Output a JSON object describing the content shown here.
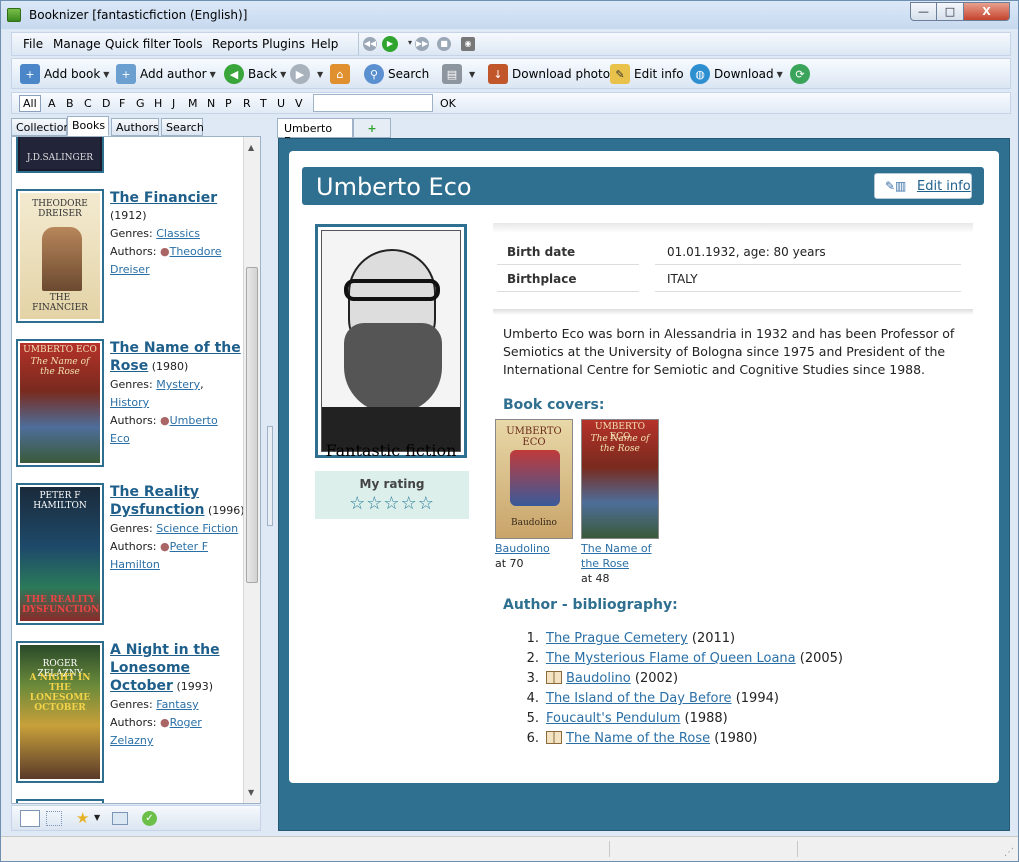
{
  "window": {
    "title": "Booknizer [fantasticfiction (English)]",
    "min_glyph": "—",
    "max_glyph": "□",
    "close_glyph": "X"
  },
  "menu": [
    "File",
    "Manage",
    "Quick filter",
    "Tools",
    "Reports",
    "Plugins",
    "Help"
  ],
  "toolbar": {
    "add_book": "Add book",
    "add_author": "Add author",
    "back": "Back",
    "search": "Search",
    "download_photo": "Download photo",
    "edit_info": "Edit info",
    "download": "Download"
  },
  "alphabet": {
    "all": "All",
    "letters": [
      "A",
      "B",
      "C",
      "D",
      "F",
      "G",
      "H",
      "J",
      "M",
      "N",
      "P",
      "R",
      "T",
      "U",
      "V"
    ],
    "ok": "OK",
    "filter_value": ""
  },
  "left_tabs": [
    "Collection",
    "Books",
    "Authors",
    "Search"
  ],
  "book_list": [
    {
      "title": "The Financier",
      "year": "(1912)",
      "genres_label": "Genres:",
      "genres": "Classics",
      "authors_label": "Authors:",
      "author": "Theodore Dreiser",
      "author_a": "Theodore",
      "author_b": "Dreiser",
      "cover_top": "THEODORE DREISER",
      "cover_bottom": "THE FINANCIER"
    },
    {
      "title": "The Name of the Rose",
      "year": "(1980)",
      "title_a": "The Name of the",
      "title_b": "Rose",
      "genres_label": "Genres:",
      "genre_a": "Mystery",
      "genre_b": "History",
      "authors_label": "Authors:",
      "author_a": "Umberto",
      "author_b": "Eco",
      "cover_top": "UMBERTO ECO",
      "cover_sub": "The Name of the Rose"
    },
    {
      "title_a": "The Reality",
      "title_b": "Dysfunction",
      "year": "(1996)",
      "genres_label": "Genres:",
      "genres": "Science Fiction",
      "authors_label": "Authors:",
      "author_a": "Peter F",
      "author_b": "Hamilton",
      "cover_top": "PETER F HAMILTON",
      "cover_bottom": "THE REALITY DYSFUNCTION"
    },
    {
      "title_a": "A Night in the",
      "title_b": "Lonesome",
      "title_c": "October",
      "year": "(1993)",
      "genres_label": "Genres:",
      "genres": "Fantasy",
      "authors_label": "Authors:",
      "author_a": "Roger",
      "author_b": "Zelazny",
      "cover_top": "ROGER ZELAZNY",
      "cover_mid": "A NIGHT IN THE LONESOME OCTOBER"
    }
  ],
  "top_cover_text": "J.D.SALINGER",
  "right_tabs": [
    "Umberto Eco",
    "+"
  ],
  "author": {
    "name": "Umberto Eco",
    "edit_info": "Edit info",
    "source": "Fantastic fiction",
    "rating_label": "My rating",
    "rating_stars": "☆☆☆☆☆",
    "rating_value": 0,
    "facts": [
      {
        "key": "Birth date",
        "value": "01.01.1932, age: 80 years"
      },
      {
        "key": "Birthplace",
        "value": "ITALY"
      }
    ],
    "bio": "Umberto Eco was born in Alessandria in 1932 and has been Professor of Semiotics at the University of Bologna since 1975 and President of the International Centre for Semiotic and Cognitive Studies since 1988.",
    "covers_heading": "Book covers:",
    "covers": [
      {
        "link": "Baudolino",
        "at": "at 70",
        "cover_top": "UMBERTO ECO",
        "cover_bottom": "Baudolino"
      },
      {
        "link_a": "The Name of",
        "link_b": "the Rose",
        "at": "at 48",
        "cover_top": "UMBERTO ECO",
        "cover_sub": "The Name of the Rose"
      }
    ],
    "bibliography_heading": "Author - bibliography:",
    "bibliography": [
      {
        "n": "1.",
        "title": "The Prague Cemetery",
        "year": "(2011)",
        "owned": false
      },
      {
        "n": "2.",
        "title": "The Mysterious Flame of Queen Loana",
        "year": "(2005)",
        "owned": false
      },
      {
        "n": "3.",
        "title": "Baudolino",
        "year": "(2002)",
        "owned": true
      },
      {
        "n": "4.",
        "title": "The Island of the Day Before",
        "year": "(1994)",
        "owned": false
      },
      {
        "n": "5.",
        "title": "Foucault's Pendulum",
        "year": "(1988)",
        "owned": false
      },
      {
        "n": "6.",
        "title": "The Name of the Rose",
        "year": "(1980)",
        "owned": true
      }
    ]
  },
  "colors": {
    "accent": "#2f6f8f",
    "link": "#2a6fa6"
  }
}
